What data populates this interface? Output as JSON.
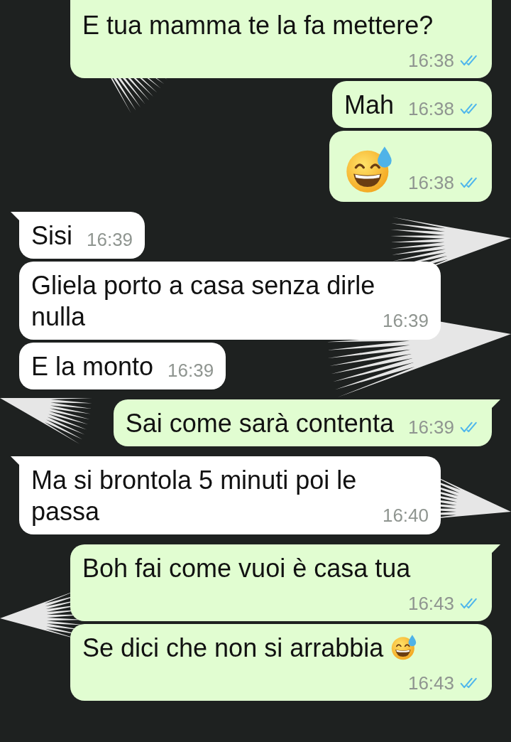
{
  "messages": [
    {
      "kind": "outgoing_text",
      "text": "E tua mamma te la fa mettere?",
      "time": "16:38",
      "read": true,
      "tail": false
    },
    {
      "kind": "outgoing_text",
      "text": "Mah",
      "time": "16:38",
      "read": true,
      "tail": false
    },
    {
      "kind": "outgoing_emoji",
      "time": "16:38",
      "read": true,
      "tail": false
    },
    {
      "kind": "incoming_text",
      "text": "Sisi",
      "time": "16:39",
      "tail": true
    },
    {
      "kind": "incoming_text",
      "text": "Gliela porto a casa senza dirle nulla",
      "time": "16:39",
      "tail": false
    },
    {
      "kind": "incoming_text",
      "text": "E la monto",
      "time": "16:39",
      "tail": false
    },
    {
      "kind": "outgoing_text",
      "text": "Sai come sarà contenta",
      "time": "16:39",
      "read": true,
      "tail": true
    },
    {
      "kind": "incoming_text",
      "text": "Ma si brontola 5 minuti poi le passa",
      "time": "16:40",
      "tail": true
    },
    {
      "kind": "outgoing_text",
      "text": "Boh fai come vuoi è casa tua",
      "time": "16:43",
      "read": true,
      "tail": true
    },
    {
      "kind": "outgoing_text_emoji",
      "text": "Se dici che non si arrabbia",
      "time": "16:43",
      "read": true,
      "tail": false
    }
  ]
}
